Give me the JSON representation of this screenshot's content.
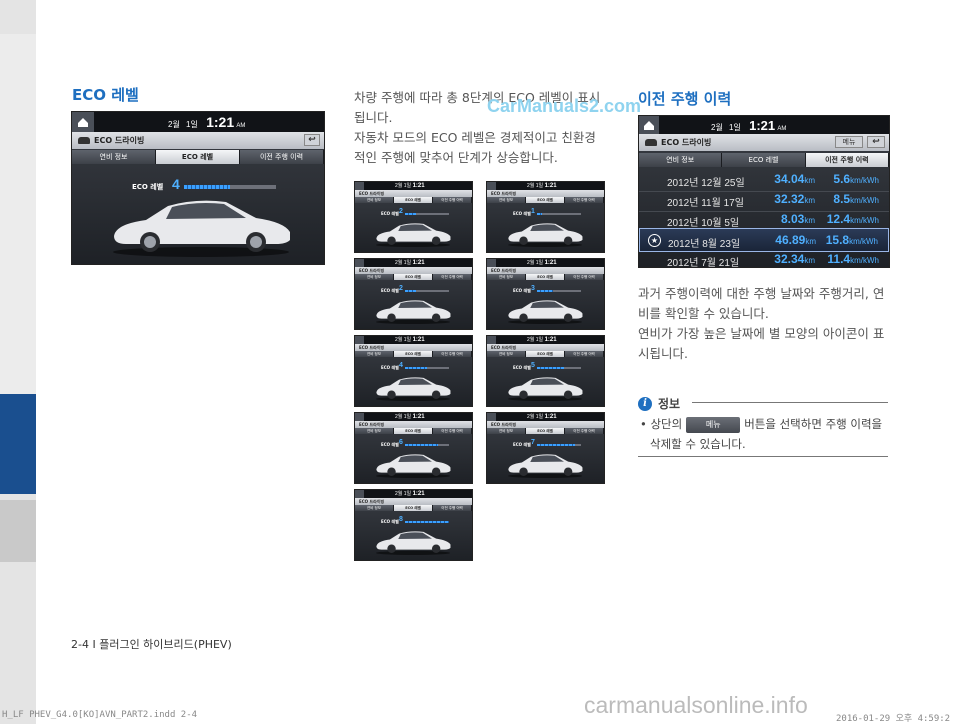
{
  "left": {
    "heading": "ECO 레벨",
    "screen": {
      "month": "2월",
      "day": "1일",
      "time": "1:21",
      "ampm": "AM",
      "title": "ECO 드라이빙",
      "tabs": [
        "연비 정보",
        "ECO 레벨",
        "이전 주행 이력"
      ],
      "eco_label": "ECO 레벨",
      "eco_level": "4",
      "eco_fraction": 0.5
    }
  },
  "middle": {
    "paragraph1_line1": "차량 주행에 따라 총 8단계의 ECO 레벨이 표시",
    "paragraph1_line2": "됩니다.",
    "paragraph2_line1": "자동차 모드의 ECO 레벨은 경제적이고 친환경",
    "paragraph2_line2": "적인 주행에 맞추어 단계가 상승합니다.",
    "watermark": "CarManuals2.com",
    "thumbnails": [
      {
        "level": "2",
        "fraction": 0.25
      },
      {
        "level": "1",
        "fraction": 0.12
      },
      {
        "level": "2",
        "fraction": 0.25
      },
      {
        "level": "3",
        "fraction": 0.37
      },
      {
        "level": "4",
        "fraction": 0.5
      },
      {
        "level": "5",
        "fraction": 0.62
      },
      {
        "level": "6",
        "fraction": 0.75
      },
      {
        "level": "7",
        "fraction": 0.87
      },
      {
        "level": "8",
        "fraction": 1.0
      }
    ]
  },
  "right": {
    "heading": "이전 주행 이력",
    "screen": {
      "month": "2월",
      "day": "1일",
      "time": "1:21",
      "ampm": "AM",
      "title": "ECO 드라이빙",
      "menu_label": "메뉴",
      "tabs": [
        "연비 정보",
        "ECO 레벨",
        "이전 주행 이력"
      ],
      "rows": [
        {
          "date": "2012년 12월 25일",
          "distance": "34.04",
          "dist_unit": "km",
          "efficiency": "5.6",
          "eff_unit": "km/kWh",
          "best": false
        },
        {
          "date": "2012년 11월 17일",
          "distance": "32.32",
          "dist_unit": "km",
          "efficiency": "8.5",
          "eff_unit": "km/kWh",
          "best": false
        },
        {
          "date": "2012년 10월  5일",
          "distance": "8.03",
          "dist_unit": "km",
          "efficiency": "12.4",
          "eff_unit": "km/kWh",
          "best": false
        },
        {
          "date": "2012년  8월 23일",
          "distance": "46.89",
          "dist_unit": "km",
          "efficiency": "15.8",
          "eff_unit": "km/kWh",
          "best": true
        },
        {
          "date": "2012년  7월 21일",
          "distance": "32.34",
          "dist_unit": "km",
          "efficiency": "11.4",
          "eff_unit": "km/kWh",
          "best": false
        }
      ]
    },
    "paragraph1_line1": "과거 주행이력에 대한 주행 날짜와 주행거리, 연",
    "paragraph1_line2": "비를 확인할 수 있습니다.",
    "paragraph2_line1": "연비가 가장 높은 날짜에 별 모양의 아이콘이 표",
    "paragraph2_line2": "시됩니다.",
    "info_title": "정보",
    "info_bullet": "•",
    "info_pre": "상단의",
    "info_button": "메뉴",
    "info_post": "버튼을 선택하면 주행 이력을",
    "info_line2": "삭제할 수 있습니다."
  },
  "footer": {
    "page_label": "2-4 I 플러그인 하이브리드(PHEV)",
    "file": "H_LF PHEV_G4.0[KO]AVN_PART2.indd   2-4",
    "site": "carmanualsonline.info",
    "date": "2016-01-29   오후 4:59:2"
  }
}
